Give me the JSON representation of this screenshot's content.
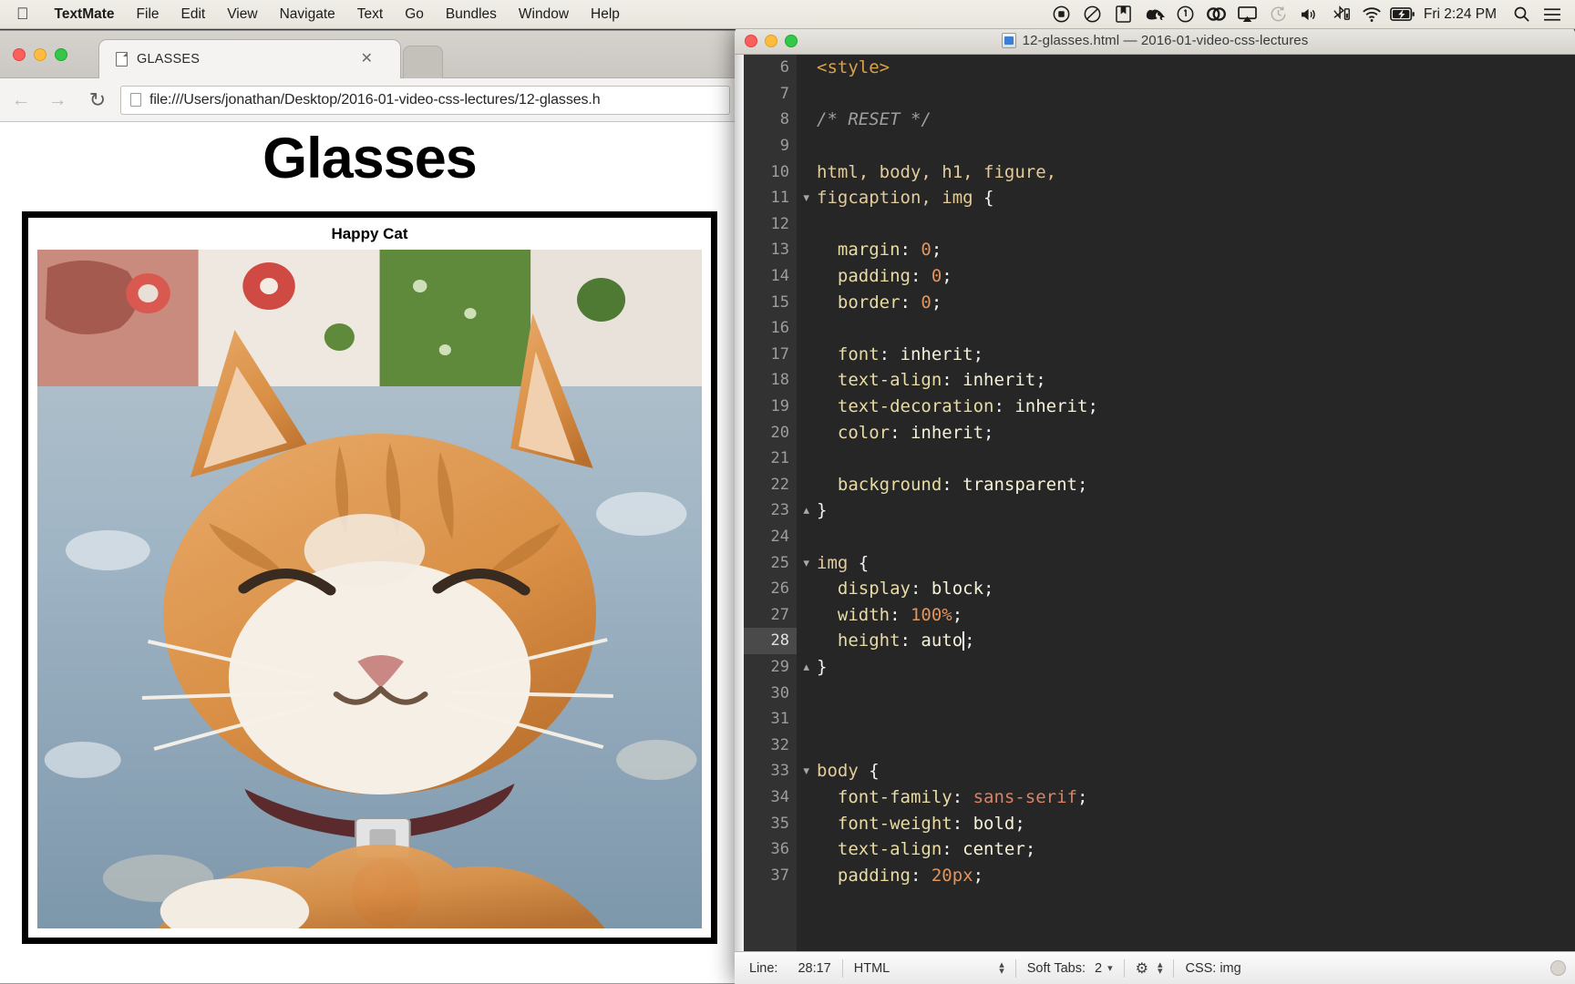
{
  "menubar": {
    "apple_icon": "apple-logo",
    "items": [
      "TextMate",
      "File",
      "Edit",
      "View",
      "Navigate",
      "Text",
      "Go",
      "Bundles",
      "Window",
      "Help"
    ],
    "tray_icons": [
      "screen-record-icon",
      "grammarly-icon",
      "bookmark-icon",
      "evernote-icon",
      "onepassword-icon",
      "creative-cloud-icon",
      "airplay-icon",
      "timemachine-icon",
      "volume-icon",
      "bluetooth-icon",
      "wifi-icon",
      "battery-charging-icon"
    ],
    "clock": "Fri 2:24 PM",
    "search_icon": "spotlight-search-icon",
    "notification_icon": "notification-center-icon"
  },
  "browser": {
    "tab": {
      "title": "GLASSES",
      "icon": "page-icon",
      "close": "✕"
    },
    "toolbar": {
      "back_icon": "back-arrow-icon",
      "forward_icon": "forward-arrow-icon",
      "reload_icon": "reload-icon",
      "url": "file:///Users/jonathan/Desktop/2016-01-video-css-lectures/12-glasses.h"
    },
    "page": {
      "heading": "Glasses",
      "figcaption": "Happy Cat",
      "image_alt": "happy-cat-photo"
    }
  },
  "textmate": {
    "title": "12-glasses.html — 2016-01-video-css-lectures",
    "doc_icon": "html-document-icon",
    "lines": [
      {
        "n": "6",
        "fold": "",
        "active": false,
        "tokens": [
          {
            "t": "<style>",
            "c": "tok-tag"
          }
        ]
      },
      {
        "n": "7",
        "fold": "",
        "active": false,
        "tokens": []
      },
      {
        "n": "8",
        "fold": "",
        "active": false,
        "tokens": [
          {
            "t": "/* RESET */",
            "c": "tok-com"
          }
        ]
      },
      {
        "n": "9",
        "fold": "",
        "active": false,
        "tokens": []
      },
      {
        "n": "10",
        "fold": "",
        "active": false,
        "tokens": [
          {
            "t": "html, body, h1, figure,",
            "c": "tok-sel"
          }
        ]
      },
      {
        "n": "11",
        "fold": "▼",
        "active": false,
        "tokens": [
          {
            "t": "figcaption, img ",
            "c": "tok-sel"
          },
          {
            "t": "{",
            "c": "tok-punc"
          }
        ]
      },
      {
        "n": "12",
        "fold": "",
        "active": false,
        "tokens": []
      },
      {
        "n": "13",
        "fold": "",
        "active": false,
        "tokens": [
          {
            "t": "  margin",
            "c": "tok-prop"
          },
          {
            "t": ": ",
            "c": "tok-punc"
          },
          {
            "t": "0",
            "c": "tok-num"
          },
          {
            "t": ";",
            "c": "tok-punc"
          }
        ]
      },
      {
        "n": "14",
        "fold": "",
        "active": false,
        "tokens": [
          {
            "t": "  padding",
            "c": "tok-prop"
          },
          {
            "t": ": ",
            "c": "tok-punc"
          },
          {
            "t": "0",
            "c": "tok-num"
          },
          {
            "t": ";",
            "c": "tok-punc"
          }
        ]
      },
      {
        "n": "15",
        "fold": "",
        "active": false,
        "tokens": [
          {
            "t": "  border",
            "c": "tok-prop"
          },
          {
            "t": ": ",
            "c": "tok-punc"
          },
          {
            "t": "0",
            "c": "tok-num"
          },
          {
            "t": ";",
            "c": "tok-punc"
          }
        ]
      },
      {
        "n": "16",
        "fold": "",
        "active": false,
        "tokens": []
      },
      {
        "n": "17",
        "fold": "",
        "active": false,
        "tokens": [
          {
            "t": "  font",
            "c": "tok-prop"
          },
          {
            "t": ": ",
            "c": "tok-punc"
          },
          {
            "t": "inherit",
            "c": "tok-val"
          },
          {
            "t": ";",
            "c": "tok-punc"
          }
        ]
      },
      {
        "n": "18",
        "fold": "",
        "active": false,
        "tokens": [
          {
            "t": "  text-align",
            "c": "tok-prop"
          },
          {
            "t": ": ",
            "c": "tok-punc"
          },
          {
            "t": "inherit",
            "c": "tok-val"
          },
          {
            "t": ";",
            "c": "tok-punc"
          }
        ]
      },
      {
        "n": "19",
        "fold": "",
        "active": false,
        "tokens": [
          {
            "t": "  text-decoration",
            "c": "tok-prop"
          },
          {
            "t": ": ",
            "c": "tok-punc"
          },
          {
            "t": "inherit",
            "c": "tok-val"
          },
          {
            "t": ";",
            "c": "tok-punc"
          }
        ]
      },
      {
        "n": "20",
        "fold": "",
        "active": false,
        "tokens": [
          {
            "t": "  color",
            "c": "tok-prop"
          },
          {
            "t": ": ",
            "c": "tok-punc"
          },
          {
            "t": "inherit",
            "c": "tok-val"
          },
          {
            "t": ";",
            "c": "tok-punc"
          }
        ]
      },
      {
        "n": "21",
        "fold": "",
        "active": false,
        "tokens": []
      },
      {
        "n": "22",
        "fold": "",
        "active": false,
        "tokens": [
          {
            "t": "  background",
            "c": "tok-prop"
          },
          {
            "t": ": ",
            "c": "tok-punc"
          },
          {
            "t": "transparent",
            "c": "tok-val"
          },
          {
            "t": ";",
            "c": "tok-punc"
          }
        ]
      },
      {
        "n": "23",
        "fold": "▲",
        "active": false,
        "tokens": [
          {
            "t": "}",
            "c": "tok-punc"
          }
        ]
      },
      {
        "n": "24",
        "fold": "",
        "active": false,
        "tokens": []
      },
      {
        "n": "25",
        "fold": "▼",
        "active": false,
        "tokens": [
          {
            "t": "img ",
            "c": "tok-sel"
          },
          {
            "t": "{",
            "c": "tok-punc"
          }
        ]
      },
      {
        "n": "26",
        "fold": "",
        "active": false,
        "tokens": [
          {
            "t": "  display",
            "c": "tok-prop"
          },
          {
            "t": ": ",
            "c": "tok-punc"
          },
          {
            "t": "block",
            "c": "tok-val"
          },
          {
            "t": ";",
            "c": "tok-punc"
          }
        ]
      },
      {
        "n": "27",
        "fold": "",
        "active": false,
        "tokens": [
          {
            "t": "  width",
            "c": "tok-prop"
          },
          {
            "t": ": ",
            "c": "tok-punc"
          },
          {
            "t": "100%",
            "c": "tok-num"
          },
          {
            "t": ";",
            "c": "tok-punc"
          }
        ]
      },
      {
        "n": "28",
        "fold": "",
        "active": true,
        "caret_after": 2,
        "tokens": [
          {
            "t": "  height",
            "c": "tok-prop"
          },
          {
            "t": ": ",
            "c": "tok-punc"
          },
          {
            "t": "auto",
            "c": "tok-val"
          },
          {
            "t": ";",
            "c": "tok-punc"
          }
        ]
      },
      {
        "n": "29",
        "fold": "▲",
        "active": false,
        "tokens": [
          {
            "t": "}",
            "c": "tok-punc"
          }
        ]
      },
      {
        "n": "30",
        "fold": "",
        "active": false,
        "tokens": []
      },
      {
        "n": "31",
        "fold": "",
        "active": false,
        "tokens": []
      },
      {
        "n": "32",
        "fold": "",
        "active": false,
        "tokens": []
      },
      {
        "n": "33",
        "fold": "▼",
        "active": false,
        "tokens": [
          {
            "t": "body ",
            "c": "tok-sel"
          },
          {
            "t": "{",
            "c": "tok-punc"
          }
        ]
      },
      {
        "n": "34",
        "fold": "",
        "active": false,
        "tokens": [
          {
            "t": "  font-family",
            "c": "tok-prop"
          },
          {
            "t": ": ",
            "c": "tok-punc"
          },
          {
            "t": "sans-serif",
            "c": "tok-str"
          },
          {
            "t": ";",
            "c": "tok-punc"
          }
        ]
      },
      {
        "n": "35",
        "fold": "",
        "active": false,
        "tokens": [
          {
            "t": "  font-weight",
            "c": "tok-prop"
          },
          {
            "t": ": ",
            "c": "tok-punc"
          },
          {
            "t": "bold",
            "c": "tok-val"
          },
          {
            "t": ";",
            "c": "tok-punc"
          }
        ]
      },
      {
        "n": "36",
        "fold": "",
        "active": false,
        "tokens": [
          {
            "t": "  text-align",
            "c": "tok-prop"
          },
          {
            "t": ": ",
            "c": "tok-punc"
          },
          {
            "t": "center",
            "c": "tok-val"
          },
          {
            "t": ";",
            "c": "tok-punc"
          }
        ]
      },
      {
        "n": "37",
        "fold": "",
        "active": false,
        "tokens": [
          {
            "t": "  padding",
            "c": "tok-prop"
          },
          {
            "t": ": ",
            "c": "tok-punc"
          },
          {
            "t": "20px",
            "c": "tok-num"
          },
          {
            "t": ";",
            "c": "tok-punc"
          }
        ]
      }
    ],
    "status": {
      "line_label": "Line:",
      "line_value": "28:17",
      "language": "HTML",
      "soft_tabs_label": "Soft Tabs:",
      "soft_tabs_value": "2",
      "gear_icon": "gear-icon",
      "scope": "CSS: img"
    }
  },
  "colors": {
    "editor_bg": "#262626",
    "gutter_bg": "#323232",
    "active_line_gutter": "#4a4a4a",
    "property": "#e8dba5",
    "value": "#f5f0d8",
    "number": "#e0945f",
    "string": "#db8264",
    "comment": "#9e9e9e"
  }
}
